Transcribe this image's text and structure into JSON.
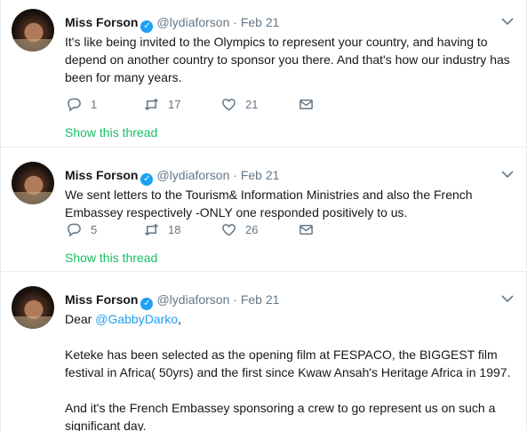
{
  "tweets": [
    {
      "name": "Miss Forson",
      "handle": "@lydiaforson",
      "date": "Feb 21",
      "text": "It's like being invited to the Olympics to represent your country, and having to depend on another country to sponsor you there. And that's how our industry has been for many years.",
      "replies": "1",
      "retweets": "17",
      "likes": "21",
      "show_thread": "Show this thread"
    },
    {
      "name": "Miss Forson",
      "handle": "@lydiaforson",
      "date": "Feb 21",
      "text": "We sent letters to the Tourism& Information Ministries and also the French Embassey respectively -ONLY one responded positively to us.",
      "replies": "5",
      "retweets": "18",
      "likes": "26",
      "show_thread": "Show this thread"
    },
    {
      "name": "Miss Forson",
      "handle": "@lydiaforson",
      "date": "Feb 21",
      "greeting_prefix": "Dear ",
      "mention": "@GabbyDarko",
      "greeting_suffix": ",",
      "paragraph_2": "Keteke has been selected as the opening film at FESPACO, the BIGGEST film festival in Africa( 50yrs) and the first since Kwaw Ansah's Heritage Africa in 1997.",
      "paragraph_3": "And it's the French Embassey sponsoring a crew to go represent us on such a significant day."
    }
  ],
  "separator": "·",
  "icons": {
    "verified": "verified-badge-icon",
    "caret": "chevron-down-icon",
    "reply": "reply-icon",
    "retweet": "retweet-icon",
    "like": "heart-icon",
    "share": "envelope-icon"
  },
  "colors": {
    "link": "#1da1f2",
    "thread": "#17bf63",
    "muted": "#657786",
    "verified": "#1da1f2"
  }
}
